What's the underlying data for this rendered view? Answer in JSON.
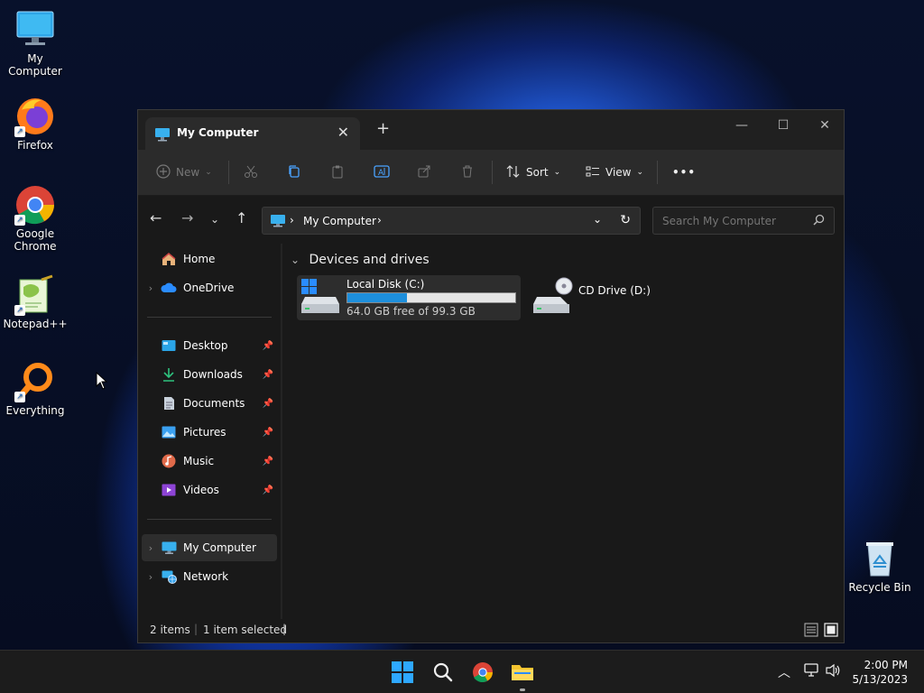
{
  "desktop": {
    "icons": [
      {
        "label": "My Computer"
      },
      {
        "label": "Firefox"
      },
      {
        "label": "Google Chrome"
      },
      {
        "label": "Notepad++"
      },
      {
        "label": "Everything"
      },
      {
        "label": "Recycle Bin"
      }
    ]
  },
  "window": {
    "tab_title": "My Computer",
    "new_tab": "+",
    "toolbar": {
      "new_label": "New",
      "sort_label": "Sort",
      "view_label": "View",
      "more_label": "•••"
    },
    "address": {
      "path": "My Computer",
      "search_placeholder": "Search My Computer"
    },
    "sidebar": {
      "items": [
        {
          "label": "Home"
        },
        {
          "label": "OneDrive"
        },
        {
          "label": "Desktop"
        },
        {
          "label": "Downloads"
        },
        {
          "label": "Documents"
        },
        {
          "label": "Pictures"
        },
        {
          "label": "Music"
        },
        {
          "label": "Videos"
        },
        {
          "label": "My Computer"
        },
        {
          "label": "Network"
        }
      ]
    },
    "content": {
      "group_title": "Devices and drives",
      "drives": [
        {
          "name": "Local Disk (C:)",
          "free": "64.0 GB free of 99.3 GB",
          "used_fraction": 0.355
        },
        {
          "name": "CD Drive (D:)"
        }
      ]
    },
    "status": {
      "items": "2 items",
      "selected": "1 item selected"
    }
  },
  "taskbar": {
    "time": "2:00 PM",
    "date": "5/13/2023"
  }
}
